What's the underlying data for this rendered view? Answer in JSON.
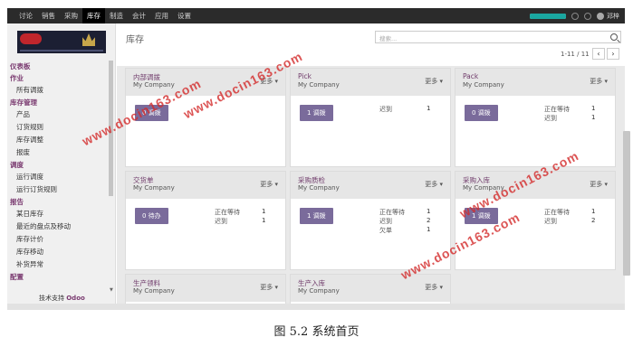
{
  "menu": [
    "讨论",
    "销售",
    "采购",
    "库存",
    "制造",
    "会计",
    "应用",
    "设置"
  ],
  "active_menu": "库存",
  "user": "邓梓",
  "progress": 1.0,
  "sidebar": {
    "sections": [
      {
        "label": "仪表板",
        "items": []
      },
      {
        "label": "作业",
        "items": [
          "所有调拨"
        ]
      },
      {
        "label": "库存管理",
        "items": [
          "产品",
          "订货规则",
          "库存调整",
          "报废"
        ]
      },
      {
        "label": "调度",
        "items": [
          "运行调度",
          "运行订货规则"
        ]
      },
      {
        "label": "报告",
        "items": [
          "某日库存",
          "最近的盘点及移动",
          "库存计价",
          "库存移动",
          "补货异常"
        ]
      },
      {
        "label": "配置",
        "items": []
      }
    ],
    "support_prefix": "技术支持",
    "support_brand": "Odoo"
  },
  "breadcrumb": "库存",
  "search": {
    "placeholder": "搜索..."
  },
  "pager": {
    "text": "1-11 / 11",
    "prev": "‹",
    "next": "›"
  },
  "cards": [
    {
      "title": "内部调拨",
      "company": "My Company",
      "more": "更多 ▾",
      "button": "0 调拨",
      "stats": []
    },
    {
      "title": "Pick",
      "company": "My Company",
      "more": "更多 ▾",
      "button": "1 调拨",
      "stats": [
        {
          "label": "迟到",
          "value": "1"
        }
      ]
    },
    {
      "title": "Pack",
      "company": "My Company",
      "more": "更多 ▾",
      "button": "0 调拨",
      "stats": [
        {
          "label": "正在等待",
          "value": "1"
        },
        {
          "label": "迟到",
          "value": "1"
        }
      ]
    },
    {
      "title": "交货单",
      "company": "My Company",
      "more": "更多 ▾",
      "button": "0 待办",
      "stats": [
        {
          "label": "正在等待",
          "value": "1"
        },
        {
          "label": "迟到",
          "value": "1"
        }
      ]
    },
    {
      "title": "采购质检",
      "company": "My Company",
      "more": "更多 ▾",
      "button": "1 调拨",
      "stats": [
        {
          "label": "正在等待",
          "value": "1"
        },
        {
          "label": "迟到",
          "value": "2"
        },
        {
          "label": "欠单",
          "value": "1"
        }
      ]
    },
    {
      "title": "采购入库",
      "company": "My Company",
      "more": "更多 ▾",
      "button": "1 调拨",
      "stats": [
        {
          "label": "正在等待",
          "value": "1"
        },
        {
          "label": "迟到",
          "value": "2"
        }
      ]
    },
    {
      "title": "生产领料",
      "company": "My Company",
      "more": "更多 ▾",
      "button": "",
      "stats": []
    },
    {
      "title": "生产入库",
      "company": "My Company",
      "more": "更多 ▾",
      "button": "",
      "stats": []
    }
  ],
  "watermarks": [
    "www.docin163.com",
    "www.docin163.com",
    "www.docin163.com",
    "www.docin163.com"
  ],
  "caption": "图 5.2  系统首页"
}
